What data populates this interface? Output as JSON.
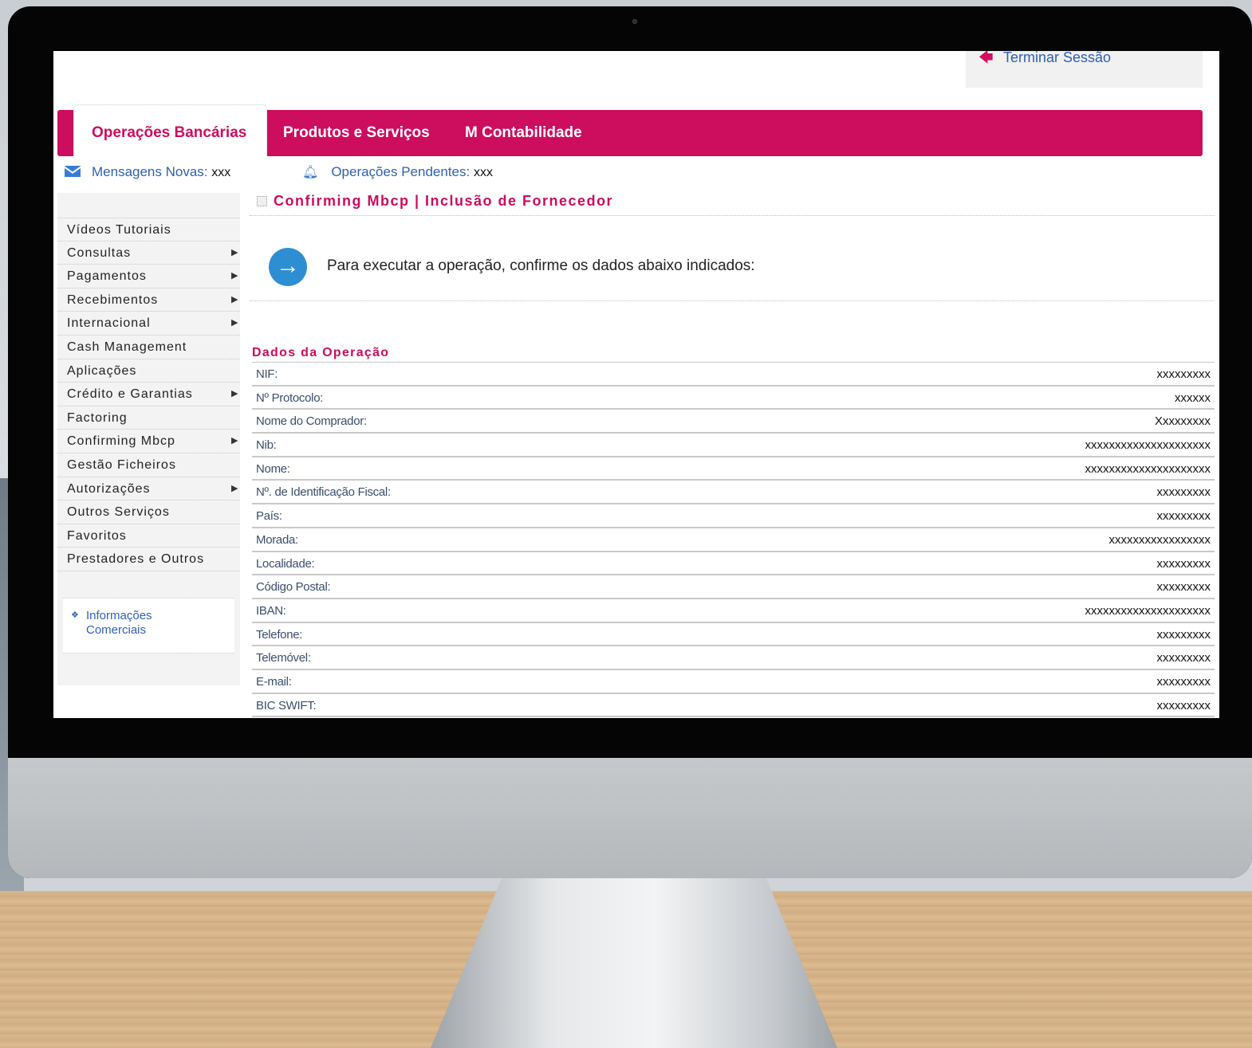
{
  "header": {
    "logout_label": "Terminar Sessão"
  },
  "nav": {
    "tabs": [
      {
        "label": "Operações Bancárias",
        "active": true
      },
      {
        "label": "Produtos e Serviços",
        "active": false
      },
      {
        "label": "M Contabilidade",
        "active": false
      }
    ]
  },
  "status": {
    "messages_label": "Mensagens Novas:",
    "messages_value": "xxx",
    "pending_label": "Operações Pendentes:",
    "pending_value": "xxx"
  },
  "sidebar": {
    "items": [
      {
        "label": "Vídeos Tutoriais",
        "submenu": false
      },
      {
        "label": "Consultas",
        "submenu": true
      },
      {
        "label": "Pagamentos",
        "submenu": true
      },
      {
        "label": "Recebimentos",
        "submenu": true
      },
      {
        "label": "Internacional",
        "submenu": true
      },
      {
        "label": "Cash Management",
        "submenu": false
      },
      {
        "label": "Aplicações",
        "submenu": false
      },
      {
        "label": "Crédito e Garantias",
        "submenu": true
      },
      {
        "label": "Factoring",
        "submenu": false
      },
      {
        "label": "Confirming Mbcp",
        "submenu": true
      },
      {
        "label": "Gestão Ficheiros",
        "submenu": false
      },
      {
        "label": "Autorizações",
        "submenu": true
      },
      {
        "label": "Outros Serviços",
        "submenu": false
      },
      {
        "label": "Favoritos",
        "submenu": false
      },
      {
        "label": "Prestadores e Outros",
        "submenu": false
      }
    ],
    "info_link": "Informações Comerciais"
  },
  "main": {
    "title": "Confirming Mbcp | Inclusão de Fornecedor",
    "instruction": "Para executar a operação, confirme os dados abaixo indicados:",
    "section_title": "Dados da Operação",
    "rows": [
      {
        "label": "NIF:",
        "value": "xxxxxxxxx"
      },
      {
        "label": "Nº Protocolo:",
        "value": "xxxxxx"
      },
      {
        "label": "Nome do Comprador:",
        "value": "Xxxxxxxxx"
      },
      {
        "label": "Nib:",
        "value": "xxxxxxxxxxxxxxxxxxxxx"
      },
      {
        "label": "Nome:",
        "value": "xxxxxxxxxxxxxxxxxxxxx"
      },
      {
        "label": "Nº. de Identificação Fiscal:",
        "value": "xxxxxxxxx"
      },
      {
        "label": "País:",
        "value": "xxxxxxxxx"
      },
      {
        "label": "Morada:",
        "value": "xxxxxxxxxxxxxxxxx"
      },
      {
        "label": "Localidade:",
        "value": "xxxxxxxxx"
      },
      {
        "label": "Código Postal:",
        "value": "xxxxxxxxx"
      },
      {
        "label": "IBAN:",
        "value": "xxxxxxxxxxxxxxxxxxxxx"
      },
      {
        "label": "Telefone:",
        "value": "xxxxxxxxx"
      },
      {
        "label": "Telemóvel:",
        "value": "xxxxxxxxx"
      },
      {
        "label": "E-mail:",
        "value": "xxxxxxxxx"
      },
      {
        "label": "BIC SWIFT:",
        "value": "xxxxxxxxx"
      }
    ]
  },
  "colors": {
    "brand": "#cd0d5e",
    "link": "#2f5fb4",
    "sidebar_bg": "#f3f3f3"
  },
  "icons": {
    "logout": "arrow-left-icon",
    "messages": "envelope-icon",
    "pending": "bell-icon",
    "instruction": "arrow-right-circle-icon",
    "title": "page-icon"
  }
}
